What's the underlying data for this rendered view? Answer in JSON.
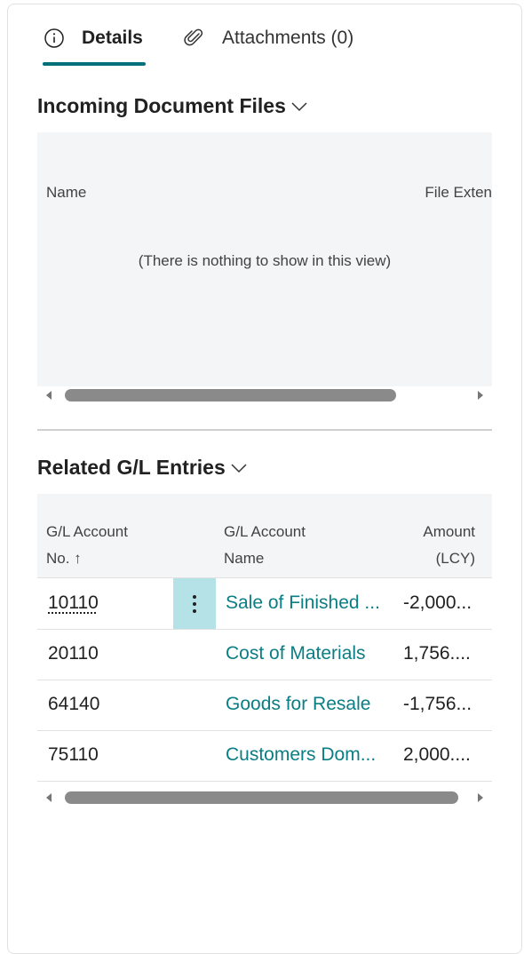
{
  "tabs": [
    {
      "label": "Details",
      "icon": "info-icon"
    },
    {
      "label": "Attachments (0)",
      "icon": "paperclip-icon"
    }
  ],
  "incoming": {
    "title": "Incoming Document Files",
    "columns": [
      "Name",
      "File Exten"
    ],
    "empty_text": "(There is nothing to show in this view)"
  },
  "gl": {
    "title": "Related G/L Entries",
    "col_acct_line1": "G/L Account",
    "col_acct_line2": "No. ↑",
    "col_name_line1": "G/L Account",
    "col_name_line2": "Name",
    "col_amt_line1": "Amount",
    "col_amt_line2": "(LCY)",
    "rows": [
      {
        "account": "10110",
        "name": "Sale of Finished ...",
        "amount": "-2,000..."
      },
      {
        "account": "20110",
        "name": "Cost of Materials",
        "amount": "1,756...."
      },
      {
        "account": "64140",
        "name": "Goods for Resale",
        "amount": "-1,756..."
      },
      {
        "account": "75110",
        "name": "Customers Dom...",
        "amount": "2,000...."
      }
    ]
  },
  "colors": {
    "accent": "#00707a",
    "link": "#0a7e84",
    "selected_cell": "#b4e2e6"
  }
}
